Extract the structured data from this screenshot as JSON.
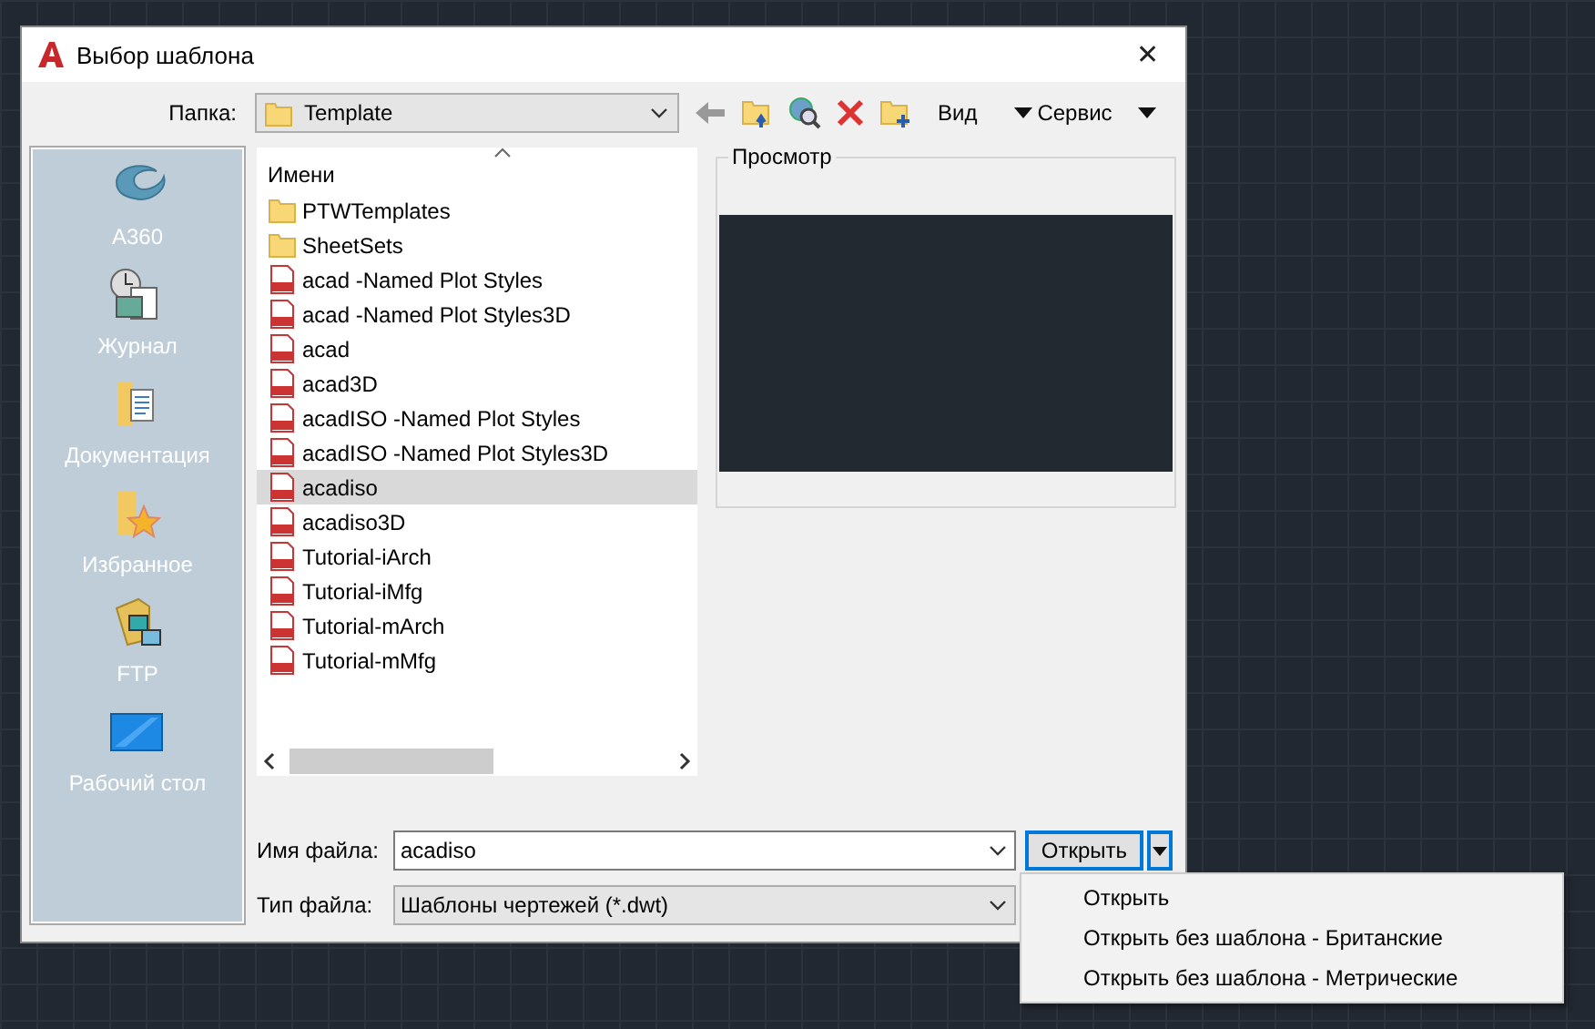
{
  "window": {
    "title": "Выбор шаблона",
    "close": "✕"
  },
  "folder": {
    "label": "Папка:",
    "value": "Template"
  },
  "toolbar": {
    "view": "Вид",
    "tools": "Сервис"
  },
  "places": [
    {
      "label": "A360"
    },
    {
      "label": "Журнал"
    },
    {
      "label": "Документация"
    },
    {
      "label": "Избранное"
    },
    {
      "label": "FTP"
    },
    {
      "label": "Рабочий стол"
    }
  ],
  "files": {
    "column": "Имени",
    "items": [
      {
        "name": "PTWTemplates",
        "kind": "folder",
        "selected": false
      },
      {
        "name": "SheetSets",
        "kind": "folder",
        "selected": false
      },
      {
        "name": "acad -Named Plot Styles",
        "kind": "dwt",
        "selected": false
      },
      {
        "name": "acad -Named Plot Styles3D",
        "kind": "dwt",
        "selected": false
      },
      {
        "name": "acad",
        "kind": "dwt",
        "selected": false
      },
      {
        "name": "acad3D",
        "kind": "dwt",
        "selected": false
      },
      {
        "name": "acadISO -Named Plot Styles",
        "kind": "dwt",
        "selected": false
      },
      {
        "name": "acadISO -Named Plot Styles3D",
        "kind": "dwt",
        "selected": false
      },
      {
        "name": "acadiso",
        "kind": "dwt",
        "selected": true
      },
      {
        "name": "acadiso3D",
        "kind": "dwt",
        "selected": false
      },
      {
        "name": "Tutorial-iArch",
        "kind": "dwt",
        "selected": false
      },
      {
        "name": "Tutorial-iMfg",
        "kind": "dwt",
        "selected": false
      },
      {
        "name": "Tutorial-mArch",
        "kind": "dwt",
        "selected": false
      },
      {
        "name": "Tutorial-mMfg",
        "kind": "dwt",
        "selected": false
      }
    ]
  },
  "preview": {
    "label": "Просмотр"
  },
  "file_name": {
    "label": "Имя файла:",
    "value": "acadiso"
  },
  "file_type": {
    "label": "Тип файла:",
    "value": "Шаблоны чертежей (*.dwt)"
  },
  "open_button": {
    "label": "Открыть"
  },
  "open_menu": {
    "expanded": true,
    "items": [
      {
        "label": "Открыть"
      },
      {
        "label": "Открыть без шаблона - Британские"
      },
      {
        "label": "Открыть без шаблона - Метрические"
      }
    ]
  }
}
